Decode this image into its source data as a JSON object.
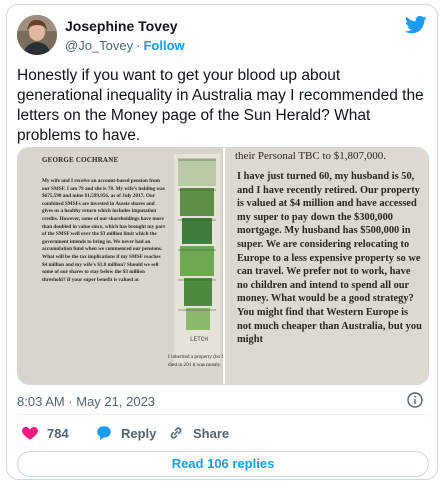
{
  "author": {
    "name": "Josephine Tovey",
    "handle": "@Jo_Tovey",
    "separator": "·",
    "follow_label": "Follow"
  },
  "tweet": {
    "text": "Honestly if you want to get your blood up about generational inequality in Australia may I recommended the letters on the Money page of the Sun Herald? What problems to have.",
    "timestamp": "8:03 AM · May 21, 2023"
  },
  "image": {
    "left": {
      "headline": "GEORGE COCHRANE",
      "body": "My wife and I receive an account-based pension from our SMSF. I am 79 and she is 78. My wife's holding was $675,590 and mine $1,599,956, as of July 2017. Our combined SMSFs are invested in Aussie shares and gives us a healthy return which includes imputation credits. However, some of our shareholdings have more than doubled in value since, which has brought my part of the SMSF well over the $3 million limit which the government intends to bring in. We never had an accumulation fund when we commenced our pensions. What will be the tax implications if my SMSF reaches $4 million and my wife's $1.8 million? Should we sell some of our shares to stay below the $3 million threshold? If your super benefit is valued at",
      "side_text": "I inherited a property (bo he died in 201 it was mostly",
      "cartoon_label": "LETCH"
    },
    "right": {
      "top_line": "their Personal TBC to $1,807,000.",
      "body": "I have just turned 60, my husband is 50, and I have recently retired. Our property is valued at $4 million and have accessed my super to pay down the $300,000 mortgage. My husband has $500,000 in super. We are considering relocating to Europe to a less expensive property so we can travel. We prefer not to work, have no children and intend to spend all our money. What would be a good strategy? You might find that Western Europe is not much cheaper than Australia, but you might"
    }
  },
  "actions": {
    "like_count": "784",
    "reply_label": "Reply",
    "share_label": "Share",
    "read_replies_label": "Read 106 replies"
  },
  "colors": {
    "accent": "#1d9bf0",
    "like": "#f91880",
    "muted": "#536471",
    "border": "#cfd9de"
  }
}
